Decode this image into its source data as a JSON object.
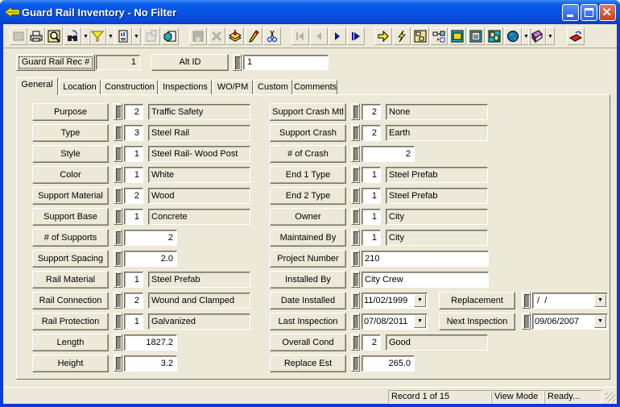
{
  "window": {
    "title": "Guard Rail Inventory - No Filter",
    "controls": [
      "minimize",
      "maximize",
      "close"
    ]
  },
  "toolbar": {
    "buttons": [
      {
        "icon": "blank-form-icon",
        "enabled": false
      },
      {
        "icon": "print-icon",
        "enabled": true
      },
      {
        "icon": "print-preview-icon",
        "enabled": true
      },
      {
        "icon": "search-binoculars-icon",
        "enabled": true,
        "dropdown": true
      },
      {
        "icon": "filter-funnel-icon",
        "enabled": true,
        "dropdown": true
      },
      {
        "icon": "report-icon",
        "enabled": true,
        "dropdown": true
      },
      {
        "icon": "edit-form-icon",
        "enabled": false
      },
      {
        "icon": "copy-record-icon",
        "enabled": true
      },
      {
        "icon": "save-icon",
        "enabled": false
      },
      {
        "icon": "delete-icon",
        "enabled": false
      },
      {
        "icon": "add-record-icon",
        "enabled": true
      },
      {
        "icon": "edit-pencil-icon",
        "enabled": true
      },
      {
        "icon": "cut-scissors-icon",
        "enabled": true
      },
      {
        "icon": "first-record-icon",
        "enabled": false
      },
      {
        "icon": "previous-record-icon",
        "enabled": false
      },
      {
        "icon": "next-record-icon",
        "enabled": true
      },
      {
        "icon": "last-record-icon",
        "enabled": true
      },
      {
        "icon": "goto-arrow-icon",
        "enabled": true
      },
      {
        "icon": "lightning-icon",
        "enabled": true
      },
      {
        "icon": "hierarchy-icon",
        "enabled": true
      },
      {
        "icon": "link-icon",
        "enabled": true
      },
      {
        "icon": "equipment-icon",
        "enabled": true
      },
      {
        "icon": "calculator-icon",
        "enabled": true
      },
      {
        "icon": "map-icon",
        "enabled": true
      },
      {
        "icon": "globe-icon",
        "enabled": true,
        "dropdown": true
      },
      {
        "icon": "help-book-icon",
        "enabled": true,
        "dropdown": true
      },
      {
        "icon": "exit-icon",
        "enabled": true
      }
    ]
  },
  "header": {
    "rec_label": "Guard Rail Rec #",
    "rec_value": "1",
    "alt_label": "Alt ID",
    "alt_value": "1"
  },
  "tabs": [
    "General",
    "Location",
    "Construction",
    "Inspections",
    "WO/PM",
    "Custom",
    "Comments"
  ],
  "active_tab": "General",
  "left_fields": [
    {
      "label": "Purpose",
      "code": "2",
      "desc": "Traffic Safety"
    },
    {
      "label": "Type",
      "code": "3",
      "desc": "Steel Rail"
    },
    {
      "label": "Style",
      "code": "1",
      "desc": "Steel Rail- Wood Post"
    },
    {
      "label": "Color",
      "code": "1",
      "desc": "White"
    },
    {
      "label": "Support Material",
      "code": "2",
      "desc": "Wood"
    },
    {
      "label": "Support Base",
      "code": "1",
      "desc": "Concrete"
    },
    {
      "label": "# of Supports",
      "value": "2"
    },
    {
      "label": "Support Spacing",
      "value": "2.0"
    },
    {
      "label": "Rail Material",
      "code": "1",
      "desc": "Steel Prefab"
    },
    {
      "label": "Rail Connection",
      "code": "2",
      "desc": "Wound and Clamped"
    },
    {
      "label": "Rail Protection",
      "code": "1",
      "desc": "Galvanized"
    },
    {
      "label": "Length",
      "value": "1827.2"
    },
    {
      "label": "Height",
      "value": "3.2"
    }
  ],
  "right_fields": [
    {
      "label": "Support Crash Mtl",
      "code": "2",
      "desc": "None"
    },
    {
      "label": "Support Crash Base",
      "code": "2",
      "desc": "Earth"
    },
    {
      "label": "# of Crash Supports",
      "value": "2"
    },
    {
      "label": "End 1 Type",
      "code": "1",
      "desc": "Steel Prefab"
    },
    {
      "label": "End 2 Type",
      "code": "1",
      "desc": "Steel Prefab"
    },
    {
      "label": "Owner",
      "code": "1",
      "desc": "City"
    },
    {
      "label": "Maintained By",
      "code": "1",
      "desc": "City"
    },
    {
      "label": "Project Number",
      "text": "210"
    },
    {
      "label": "Installed By",
      "text": "City Crew"
    },
    {
      "label": "Date Installed",
      "date": "11/02/1999"
    },
    {
      "label": "Last Inspection",
      "date": "07/08/2011"
    },
    {
      "label": "Overall Cond",
      "code": "2",
      "desc": "Good"
    },
    {
      "label": "Replace Est",
      "value": "265.0"
    }
  ],
  "extra_fields": [
    {
      "label": "Replacement",
      "date": " /  /"
    },
    {
      "label": "Next Inspection",
      "date": "09/06/2007"
    }
  ],
  "status": {
    "record": "Record 1 of 15",
    "mode": "View Mode",
    "state": "Ready..."
  }
}
